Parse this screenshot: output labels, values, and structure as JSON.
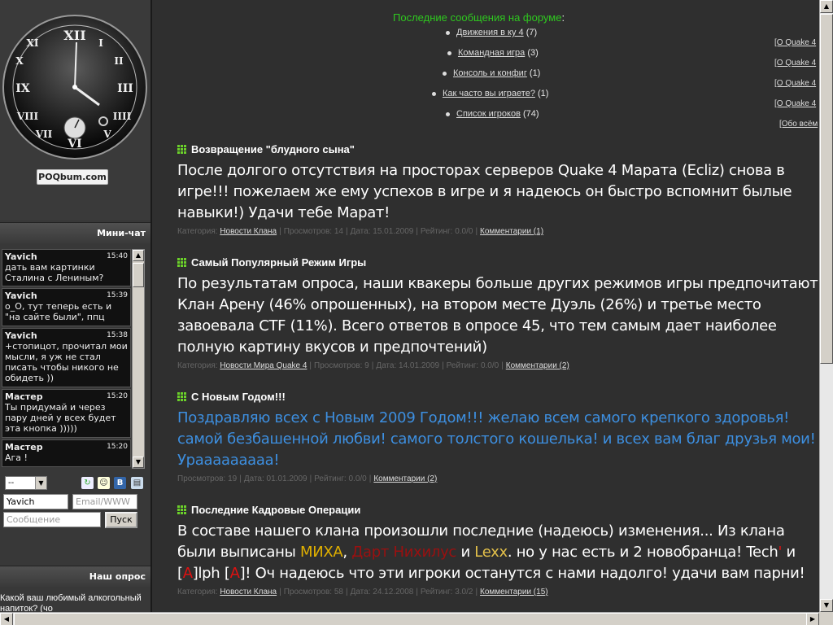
{
  "logo": {
    "text": "POQbum.com"
  },
  "chat": {
    "header": "Мини-чат",
    "messages": [
      {
        "user": "Yavich",
        "time": "15:40",
        "text": "дать вам картинки Сталина с Лениным?"
      },
      {
        "user": "Yavich",
        "time": "15:39",
        "text": "o_O, тут теперь есть и \"на сайте были\", ппц"
      },
      {
        "user": "Yavich",
        "time": "15:38",
        "text": "+стопицот, прочитал мои мысли, я уж не стал писать чтобы никого не обидеть ))"
      },
      {
        "user": "Мастер",
        "time": "15:20",
        "text": "Ты придумай и через пару дней у всех будет эта кнопка )))))"
      },
      {
        "user": "Мастер",
        "time": "15:20",
        "text": "Ага !"
      }
    ],
    "smile_select_value": "--",
    "name_value": "Yavich",
    "email_placeholder": "Email/WWW",
    "message_placeholder": "Сообщение",
    "send_label": "Пуск"
  },
  "poll": {
    "header": "Наш опрос",
    "question": "Какой ваш любимый алкогольный напиток? (чо"
  },
  "forum": {
    "title": "Последние сообщения на форуме",
    "colon": ":",
    "items": [
      {
        "label": "Движения в ку 4",
        "count": "(7)"
      },
      {
        "label": "Командная игра",
        "count": "(3)"
      },
      {
        "label": "Консоль и конфиг",
        "count": "(1)"
      },
      {
        "label": "Как часто вы играете?",
        "count": "(1)"
      },
      {
        "label": "Список игроков",
        "count": "(74)"
      }
    ]
  },
  "right_links": [
    "[О Quake 4",
    "[О Quake 4",
    "[О Quake 4",
    "[О Quake 4",
    "[Обо всём"
  ],
  "news": [
    {
      "title": "Возвращение \"блудного сына\"",
      "body": "После долгого отсутствия на просторах серверов Quake 4 Марата (Ecliz) снова в игре!!! пожелаем же ему успехов в игре и я надеюсь он быстро вспомнит былые навыки!) Удачи тебе Марат!",
      "meta": {
        "category_label": "Категория:",
        "category": "Новости Клана",
        "views": "Просмотров: 14",
        "date": "Дата: 15.01.2009",
        "rating": "Рейтинг: 0.0/0",
        "comments": "Комментарии (1)"
      }
    },
    {
      "title": "Самый Популярный Режим Игры",
      "body": "По результатам опроса, наши квакеры больше других режимов игры предпочитают Клан Арену (46% опрошенных), на втором месте Дуэль (26%) и третье место завоевала CTF (11%). Всего ответов в опросе 45, что тем самым дает наиболее полную картину вкусов и предпочтений)",
      "meta": {
        "category_label": "Категория:",
        "category": "Новости Мира Quake 4",
        "views": "Просмотров: 9",
        "date": "Дата: 14.01.2009",
        "rating": "Рейтинг: 0.0/0",
        "comments": "Комментарии (2)"
      }
    },
    {
      "title": "С Новым Годом!!!",
      "body": "Поздравляю всех с Новым 2009 Годом!!! желаю всем самого крепкого здоровья! самой безбашенной любви! самого толстого кошелька! и всех вам благ друзья мои! Урааааааааа!",
      "meta": {
        "views": "Просмотров: 19",
        "date": "Дата: 01.01.2009",
        "rating": "Рейтинг: 0.0/0",
        "comments": "Комментарии (2)"
      }
    },
    {
      "title": "Последние Кадровые Операции",
      "body_parts": {
        "p1": "В составе нашего клана произошли последние (надеюсь) изменения... Из клана были выписаны ",
        "miha": "МИХА",
        "p2": ", ",
        "dart": "Дарт Нихилус",
        "p3": " и ",
        "lexx": "Lexx",
        "p4": ". но у нас есть и 2 новобранца! Tech",
        "tick": "'",
        "p5": " и [",
        "a1": "A",
        "p6": "]lph [",
        "a2": "A",
        "p7": "]! Оч надеюсь что эти игроки останутся с нами надолго! удачи вам парни!"
      },
      "meta": {
        "category_label": "Категория:",
        "category": "Новости Клана",
        "views": "Просмотров: 58",
        "date": "Дата: 24.12.2008",
        "rating": "Рейтинг: 3.0/2",
        "comments": "Комментарии (15)"
      }
    }
  ],
  "colors": {
    "forum_title": "#2fc81f",
    "greeting_blue": "#3d8fe0",
    "bullet_green": "#6bd12a"
  }
}
